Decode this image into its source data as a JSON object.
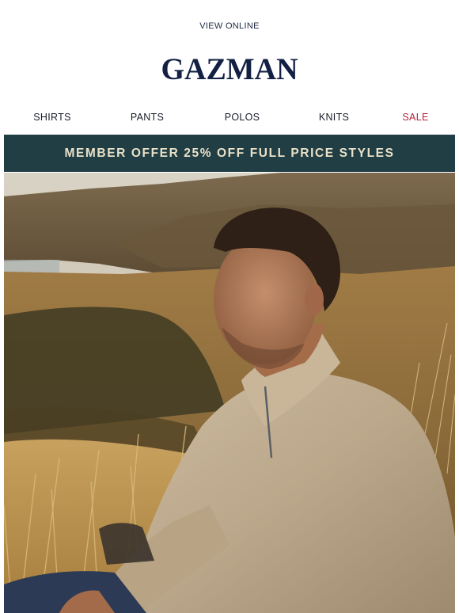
{
  "header": {
    "view_online": "VIEW ONLINE",
    "logo": "GAZMAN"
  },
  "nav": {
    "items": [
      {
        "label": "SHIRTS"
      },
      {
        "label": "PANTS"
      },
      {
        "label": "POLOS"
      },
      {
        "label": "KNITS"
      },
      {
        "label": "SALE"
      }
    ]
  },
  "banner": {
    "text": "MEMBER OFFER 25% OFF FULL PRICE STYLES"
  },
  "colors": {
    "brand_navy": "#132044",
    "banner_bg": "#213e44",
    "banner_text": "#e9e1c9",
    "sale_red": "#b3263a"
  }
}
